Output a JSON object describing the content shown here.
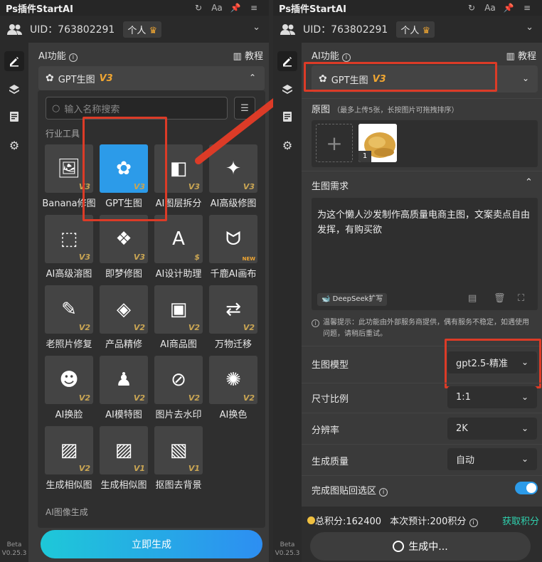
{
  "app_title": "Ps插件StartAI",
  "uid_label": "UID：763802291",
  "account_badge": "个人",
  "section_ai": "AI功能",
  "tutorial": "教程",
  "selected_tool": "GPT生图",
  "version_badge": "V3",
  "beta": "Beta",
  "version": "V0.25.3",
  "colors": {
    "accent": "#2c9be9",
    "badge": "#f0a632",
    "highlight": "#dc3b27"
  },
  "left": {
    "search_placeholder": "输入名称搜索",
    "section_industry": "行业工具",
    "section_image": "AI图像生成",
    "tools": [
      {
        "label": "Banana修图",
        "badge": "V3",
        "icon": "image-edit-icon"
      },
      {
        "label": "GPT生图",
        "badge": "V3",
        "icon": "openai-icon"
      },
      {
        "label": "AI图层拆分",
        "badge": "V3",
        "icon": "layers-split-icon"
      },
      {
        "label": "AI高级修图",
        "badge": "V3",
        "icon": "magic-wand-icon"
      },
      {
        "label": "AI高级溶图",
        "badge": "V3",
        "icon": "blend-icon"
      },
      {
        "label": "即梦修图",
        "badge": "V3",
        "icon": "jimeng-icon"
      },
      {
        "label": "AI设计助理",
        "badge": "$",
        "icon": "design-assistant-icon"
      },
      {
        "label": "千鹿AI画布",
        "badge": "NEW",
        "icon": "deer-icon"
      },
      {
        "label": "老照片修复",
        "badge": "V2",
        "icon": "photo-repair-icon"
      },
      {
        "label": "产品精修",
        "badge": "V2",
        "icon": "diamond-icon"
      },
      {
        "label": "AI商品图",
        "badge": "V2",
        "icon": "shopping-bag-icon"
      },
      {
        "label": "万物迁移",
        "badge": "V2",
        "icon": "transfer-icon"
      },
      {
        "label": "AI换脸",
        "badge": "V2",
        "icon": "face-icon"
      },
      {
        "label": "AI模特图",
        "badge": "V2",
        "icon": "model-icon"
      },
      {
        "label": "图片去水印",
        "badge": "V2",
        "icon": "no-watermark-icon"
      },
      {
        "label": "AI换色",
        "badge": "V2",
        "icon": "palette-icon"
      },
      {
        "label": "生成相似图",
        "badge": "V2",
        "icon": "similar-image-icon"
      },
      {
        "label": "生成相似图",
        "badge": "V1",
        "icon": "similar-image-icon"
      },
      {
        "label": "抠图去背景",
        "badge": "V1",
        "icon": "remove-bg-icon"
      }
    ],
    "generate_button": "立即生成"
  },
  "right": {
    "original_label": "原图",
    "original_hint": "（最多上传5张，长按图片可拖拽排序）",
    "thumb_index": "1",
    "prompt_section": "生图需求",
    "prompt_text": "为这个懒人沙发制作高质量电商主图，文案卖点自由发挥，有购买欲",
    "deepseek": "DeepSeek扩写",
    "notice": "温馨提示：此功能由外部服务商提供，偶有服务不稳定，如遇使用问题，请稍后重试。",
    "model_label": "生图模型",
    "model_value": "gpt2.5-精准",
    "ratio_label": "尺寸比例",
    "ratio_value": "1:1",
    "resolution_label": "分辨率",
    "resolution_value": "2K",
    "quality_label": "生成质量",
    "quality_value": "自动",
    "paste_label": "完成图贴回选区",
    "points_total": "总积分:162400",
    "points_estimate": "本次预计:200积分",
    "get_points": "获取积分",
    "generating": "生成中..."
  }
}
